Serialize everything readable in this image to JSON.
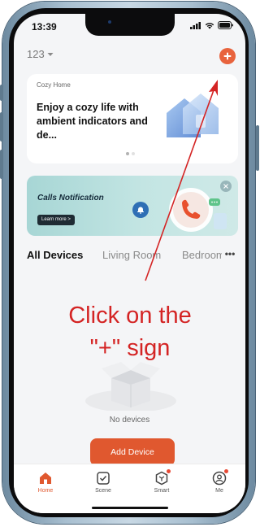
{
  "status_bar": {
    "time": "13:39",
    "icons": [
      "cellular-signal-icon",
      "wifi-icon",
      "battery-icon"
    ]
  },
  "header": {
    "home_name": "123",
    "add_icon": "plus-icon"
  },
  "cozy_card": {
    "kicker": "Cozy Home",
    "title": "Enjoy a cozy life with ambient indicators and de..."
  },
  "calls_banner": {
    "title": "Calls Notification",
    "cta": "Learn more >"
  },
  "rooms": {
    "tabs": [
      {
        "label": "All Devices",
        "active": true
      },
      {
        "label": "Living Room",
        "active": false
      },
      {
        "label": "Bedroom",
        "active": false
      }
    ],
    "more": "•••"
  },
  "empty_state": {
    "text": "No devices",
    "button": "Add Device"
  },
  "tab_bar": {
    "items": [
      {
        "label": "Home",
        "icon": "home-icon",
        "active": true
      },
      {
        "label": "Scene",
        "icon": "scene-icon",
        "active": false
      },
      {
        "label": "Smart",
        "icon": "smart-icon",
        "active": false
      },
      {
        "label": "Me",
        "icon": "profile-icon",
        "active": false
      }
    ]
  },
  "annotation": {
    "line1": "Click on the",
    "line2": "\"+\"  sign"
  },
  "colors": {
    "accent": "#e0582f",
    "annotation": "#d42424",
    "banner": "#b6dedd"
  }
}
